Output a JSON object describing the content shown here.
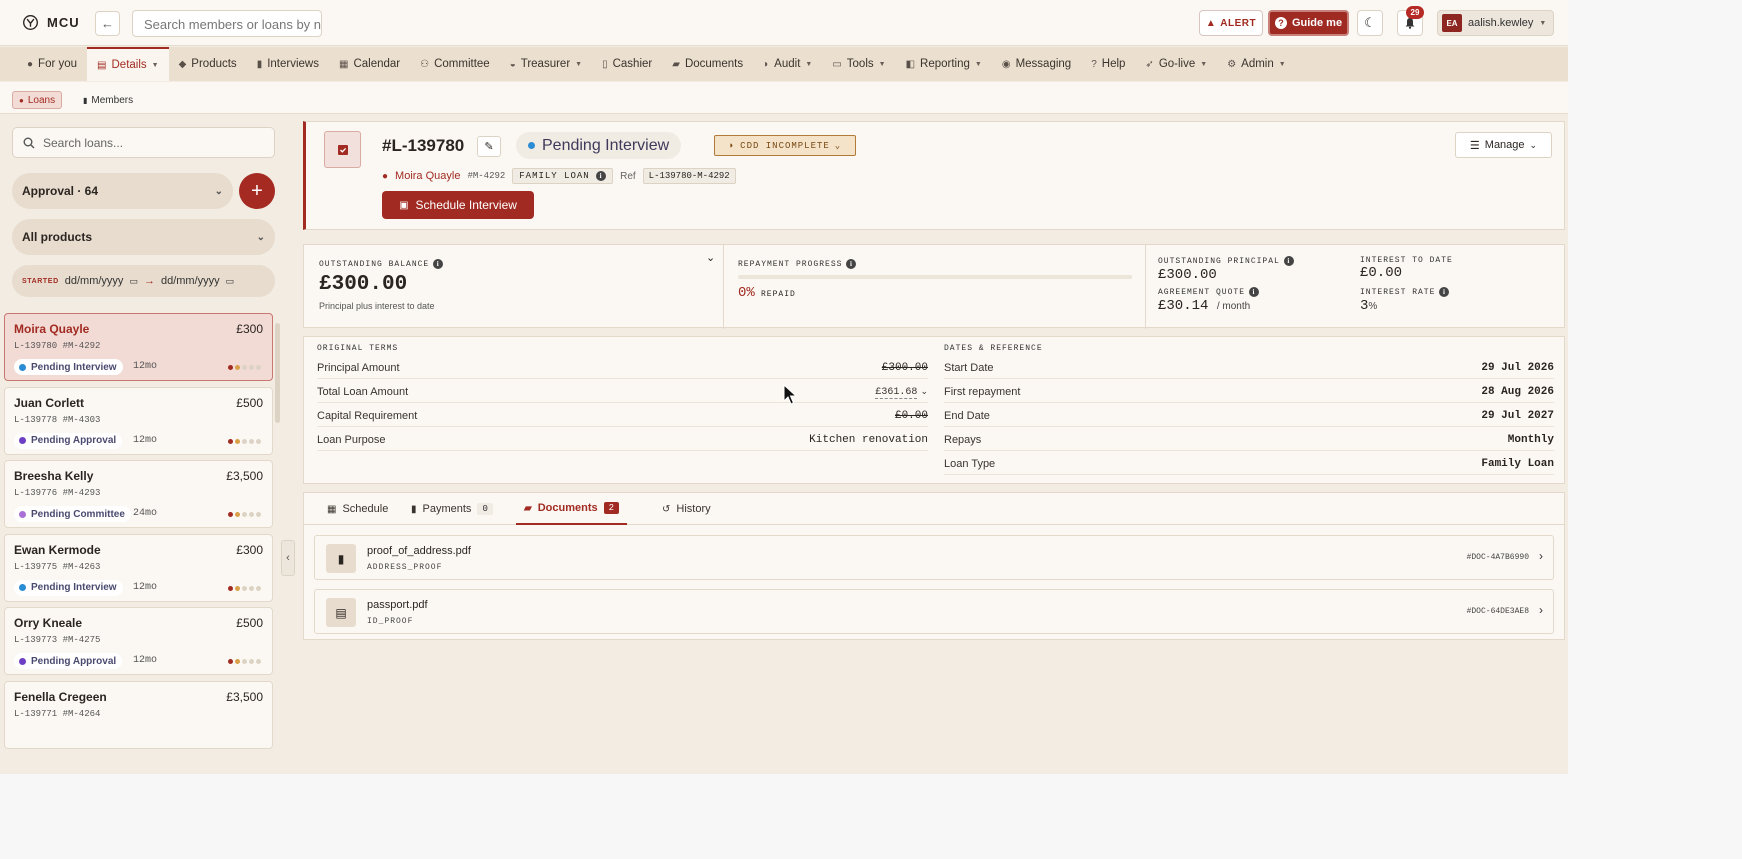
{
  "app": {
    "logo_text": "MCU"
  },
  "topbar": {
    "search_placeholder": "Search members or loans by nam",
    "alert_label": "ALERT",
    "guide_label": "Guide me",
    "notifications_count": "29",
    "user_initials": "EA",
    "user_name": "aalish.kewley"
  },
  "nav": {
    "items": [
      {
        "label": "For you",
        "icon": "user-circle-icon"
      },
      {
        "label": "Details",
        "icon": "id-card-icon",
        "active": true,
        "dropdown": true
      },
      {
        "label": "Products",
        "icon": "box-icon"
      },
      {
        "label": "Interviews",
        "icon": "clipboard-icon"
      },
      {
        "label": "Calendar",
        "icon": "calendar-icon"
      },
      {
        "label": "Committee",
        "icon": "users-icon"
      },
      {
        "label": "Treasurer",
        "icon": "piggy-bank-icon",
        "dropdown": true
      },
      {
        "label": "Cashier",
        "icon": "receipt-icon"
      },
      {
        "label": "Documents",
        "icon": "folder-icon"
      },
      {
        "label": "Audit",
        "icon": "shield-icon",
        "dropdown": true
      },
      {
        "label": "Tools",
        "icon": "toolbox-icon",
        "dropdown": true
      },
      {
        "label": "Reporting",
        "icon": "report-icon",
        "dropdown": true
      },
      {
        "label": "Messaging",
        "icon": "chat-icon"
      },
      {
        "label": "Help",
        "icon": "help-icon"
      },
      {
        "label": "Go-live",
        "icon": "rocket-icon",
        "dropdown": true
      },
      {
        "label": "Admin",
        "icon": "user-gear-icon",
        "dropdown": true
      }
    ]
  },
  "subnav": {
    "loans_label": "Loans",
    "members_label": "Members"
  },
  "sidebar": {
    "search_placeholder": "Search loans...",
    "approval_label": "Approval · 64",
    "products_label": "All products",
    "started_label": "STARTED",
    "date_from_placeholder": "dd/mm/yyyy",
    "date_to_placeholder": "dd/mm/yyyy",
    "loans": [
      {
        "name": "Moira Quayle",
        "amount": "£300",
        "ref": "L-139780 #M-4292",
        "status": "Pending Interview",
        "status_color": "#2a8cd4",
        "term": "12mo",
        "selected": true
      },
      {
        "name": "Juan Corlett",
        "amount": "£500",
        "ref": "L-139778 #M-4303",
        "status": "Pending Approval",
        "status_color": "#6d3fc4",
        "term": "12mo"
      },
      {
        "name": "Breesha Kelly",
        "amount": "£3,500",
        "ref": "L-139776 #M-4293",
        "status": "Pending Committee",
        "status_color": "#a970d6",
        "term": "24mo"
      },
      {
        "name": "Ewan Kermode",
        "amount": "£300",
        "ref": "L-139775 #M-4263",
        "status": "Pending Interview",
        "status_color": "#2a8cd4",
        "term": "12mo"
      },
      {
        "name": "Orry Kneale",
        "amount": "£500",
        "ref": "L-139773 #M-4275",
        "status": "Pending Approval",
        "status_color": "#6d3fc4",
        "term": "12mo"
      },
      {
        "name": "Fenella Cregeen",
        "amount": "£3,500",
        "ref": "L-139771 #M-4264",
        "status": "",
        "status_color": "",
        "term": ""
      }
    ]
  },
  "loan": {
    "id": "#L-139780",
    "status": "Pending Interview",
    "cdd_label": "CDD INCOMPLETE",
    "member_name": "Moira Quayle",
    "member_id": "#M-4292",
    "loan_type_tag": "FAMILY LOAN",
    "ref_label": "Ref",
    "ref_value": "L-139780-M-4292",
    "schedule_button": "Schedule Interview",
    "manage_button": "Manage"
  },
  "metrics": {
    "outstanding_balance_label": "OUTSTANDING BALANCE",
    "outstanding_balance": "£300.00",
    "outstanding_balance_sub": "Principal plus interest to date",
    "repayment_progress_label": "REPAYMENT PROGRESS",
    "repaid_percent": "0%",
    "repaid_fraction": 0,
    "repaid_label": "REPAID",
    "outstanding_principal_label": "OUTSTANDING PRINCIPAL",
    "outstanding_principal": "£300.00",
    "interest_to_date_label": "INTEREST TO DATE",
    "interest_to_date": "£0.00",
    "agreement_quote_label": "AGREEMENT QUOTE",
    "agreement_quote": "£30.14",
    "agreement_quote_unit": "/ month",
    "interest_rate_label": "INTEREST RATE",
    "interest_rate": "3",
    "interest_rate_unit": "%"
  },
  "original_terms": {
    "title": "ORIGINAL TERMS",
    "rows": [
      {
        "label": "Principal Amount",
        "value": "£300.00"
      },
      {
        "label": "Total Loan Amount",
        "value": "£361.68"
      },
      {
        "label": "Capital Requirement",
        "value": "£0.00"
      },
      {
        "label": "Loan Purpose",
        "value": "Kitchen renovation"
      }
    ]
  },
  "dates_reference": {
    "title": "DATES & REFERENCE",
    "rows": [
      {
        "label": "Start Date",
        "value": "29 Jul 2026"
      },
      {
        "label": "First repayment",
        "value": "28 Aug 2026"
      },
      {
        "label": "End Date",
        "value": "29 Jul 2027"
      },
      {
        "label": "Repays",
        "value": "Monthly"
      },
      {
        "label": "Loan Type",
        "value": "Family Loan"
      }
    ]
  },
  "tabs": [
    {
      "label": "Schedule",
      "count": ""
    },
    {
      "label": "Payments",
      "count": "0"
    },
    {
      "label": "Documents",
      "count": "2",
      "active": true
    },
    {
      "label": "History",
      "count": ""
    }
  ],
  "documents": [
    {
      "name": "proof_of_address.pdf",
      "type": "ADDRESS_PROOF",
      "id": "#DOC-4A7B6990",
      "icon": "file-icon"
    },
    {
      "name": "passport.pdf",
      "type": "ID_PROOF",
      "id": "#DOC-64DE3AE8",
      "icon": "id-card-icon"
    }
  ],
  "colors": {
    "accent": "#a12b22",
    "background": "#f2ece2",
    "panel": "#fbf8f3"
  }
}
